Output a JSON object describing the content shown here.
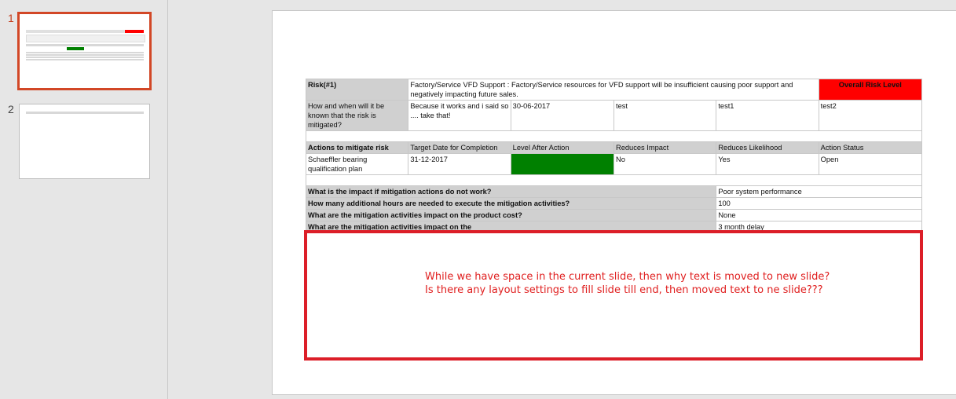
{
  "thumbnails": [
    {
      "number": "1",
      "selected": true
    },
    {
      "number": "2",
      "selected": false
    }
  ],
  "table": {
    "risk_label": "Risk(#1)",
    "risk_description": "Factory/Service VFD Support :   Factory/Service resources for VFD support will be insufficient causing poor support and negatively impacting future sales.",
    "overall_risk_level": "Overall Risk Level",
    "known_question": "How and when will it be known that the risk is mitigated?",
    "known_row": [
      "Because it works and i said so .... take that!",
      "30-06-2017",
      "test",
      "test1",
      "test2"
    ],
    "action_headers": [
      "Actions to mitigate risk",
      "Target Date for Completion",
      "Level After Action",
      "Reduces Impact",
      "Reduces Likelihood",
      "Action Status"
    ],
    "action_row": [
      "Schaeffler bearing qualification plan",
      "31-12-2017",
      "",
      "No",
      "Yes",
      "Open"
    ],
    "impact_questions": [
      {
        "q": "What is the impact if mitigation actions do not work?",
        "a": "Poor system performance"
      },
      {
        "q": "How many additional hours are needed to execute the mitigation activities?",
        "a": "100"
      },
      {
        "q": "What are the mitigation activities impact on the product cost?",
        "a": "None"
      },
      {
        "q": "What are the mitigation activities impact on the",
        "a": "3 month delay"
      }
    ]
  },
  "callout": {
    "line1": "While we have space in the current slide, then why text is moved to new slide?",
    "line2": "Is there any layout settings to fill slide till end, then moved text to ne slide???"
  },
  "colors": {
    "risk_level": "#ff0000",
    "level_after_action": "#008000",
    "callout_border": "#dc1e28",
    "selection": "#d24726"
  }
}
